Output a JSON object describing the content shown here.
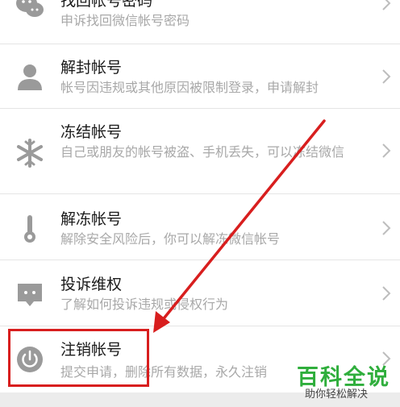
{
  "items": [
    {
      "title": "找回帐号密码",
      "subtitle": "申诉找回微信帐号密码",
      "icon": "chat-bubbles-icon"
    },
    {
      "title": "解封帐号",
      "subtitle": "帐号因违规或其他原因被限制登录，申请解封",
      "icon": "person-icon"
    },
    {
      "title": "冻结帐号",
      "subtitle": "自己或朋友的帐号被盗、手机丢失，可以冻结微信",
      "icon": "snowflake-icon"
    },
    {
      "title": "解冻帐号",
      "subtitle": "解除安全风险后，你可以解冻微信帐号",
      "icon": "thermometer-icon"
    },
    {
      "title": "投诉维权",
      "subtitle": "了解如何投诉违规或侵权行为",
      "icon": "message-dots-icon"
    },
    {
      "title": "注销帐号",
      "subtitle": "提交申请，删除所有数据，永久注销",
      "icon": "power-icon"
    }
  ],
  "watermark": {
    "title": "百科全说",
    "subtitle": "助你轻松解决"
  },
  "colors": {
    "icon": "#9a9a9a",
    "highlight": "#d81e1e",
    "arrow": "#d81e1e",
    "watermark": "#2fae3c"
  }
}
